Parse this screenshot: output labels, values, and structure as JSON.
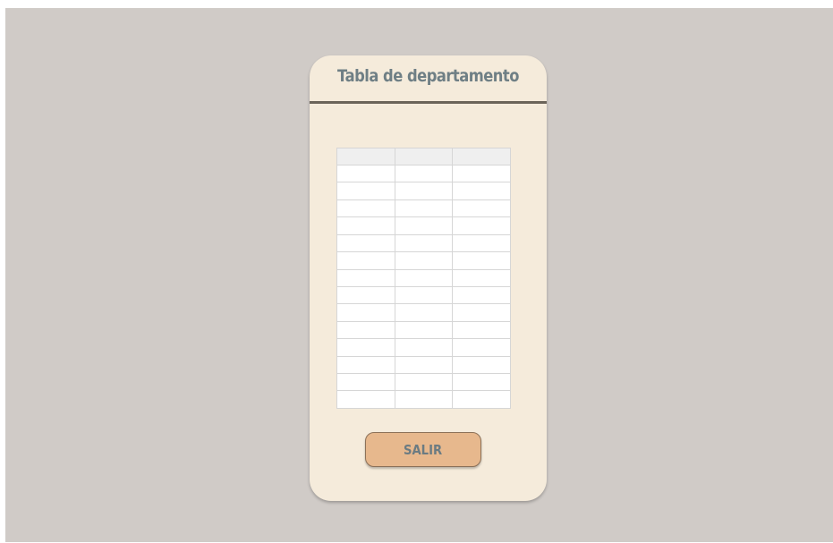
{
  "dialog": {
    "title": "Tabla de departamento",
    "table": {
      "headers": [
        "",
        "",
        ""
      ],
      "rows": [
        [
          "",
          "",
          ""
        ],
        [
          "",
          "",
          ""
        ],
        [
          "",
          "",
          ""
        ],
        [
          "",
          "",
          ""
        ],
        [
          "",
          "",
          ""
        ],
        [
          "",
          "",
          ""
        ],
        [
          "",
          "",
          ""
        ],
        [
          "",
          "",
          ""
        ],
        [
          "",
          "",
          ""
        ],
        [
          "",
          "",
          ""
        ],
        [
          "",
          "",
          ""
        ],
        [
          "",
          "",
          ""
        ],
        [
          "",
          "",
          ""
        ],
        [
          "",
          "",
          ""
        ]
      ]
    },
    "exit_label": "SALIR"
  },
  "colors": {
    "background": "#d0cbc7",
    "card": "#f5ebdb",
    "title": "#6f7f85",
    "divider": "#6b6459",
    "button": "#e7b88d"
  }
}
